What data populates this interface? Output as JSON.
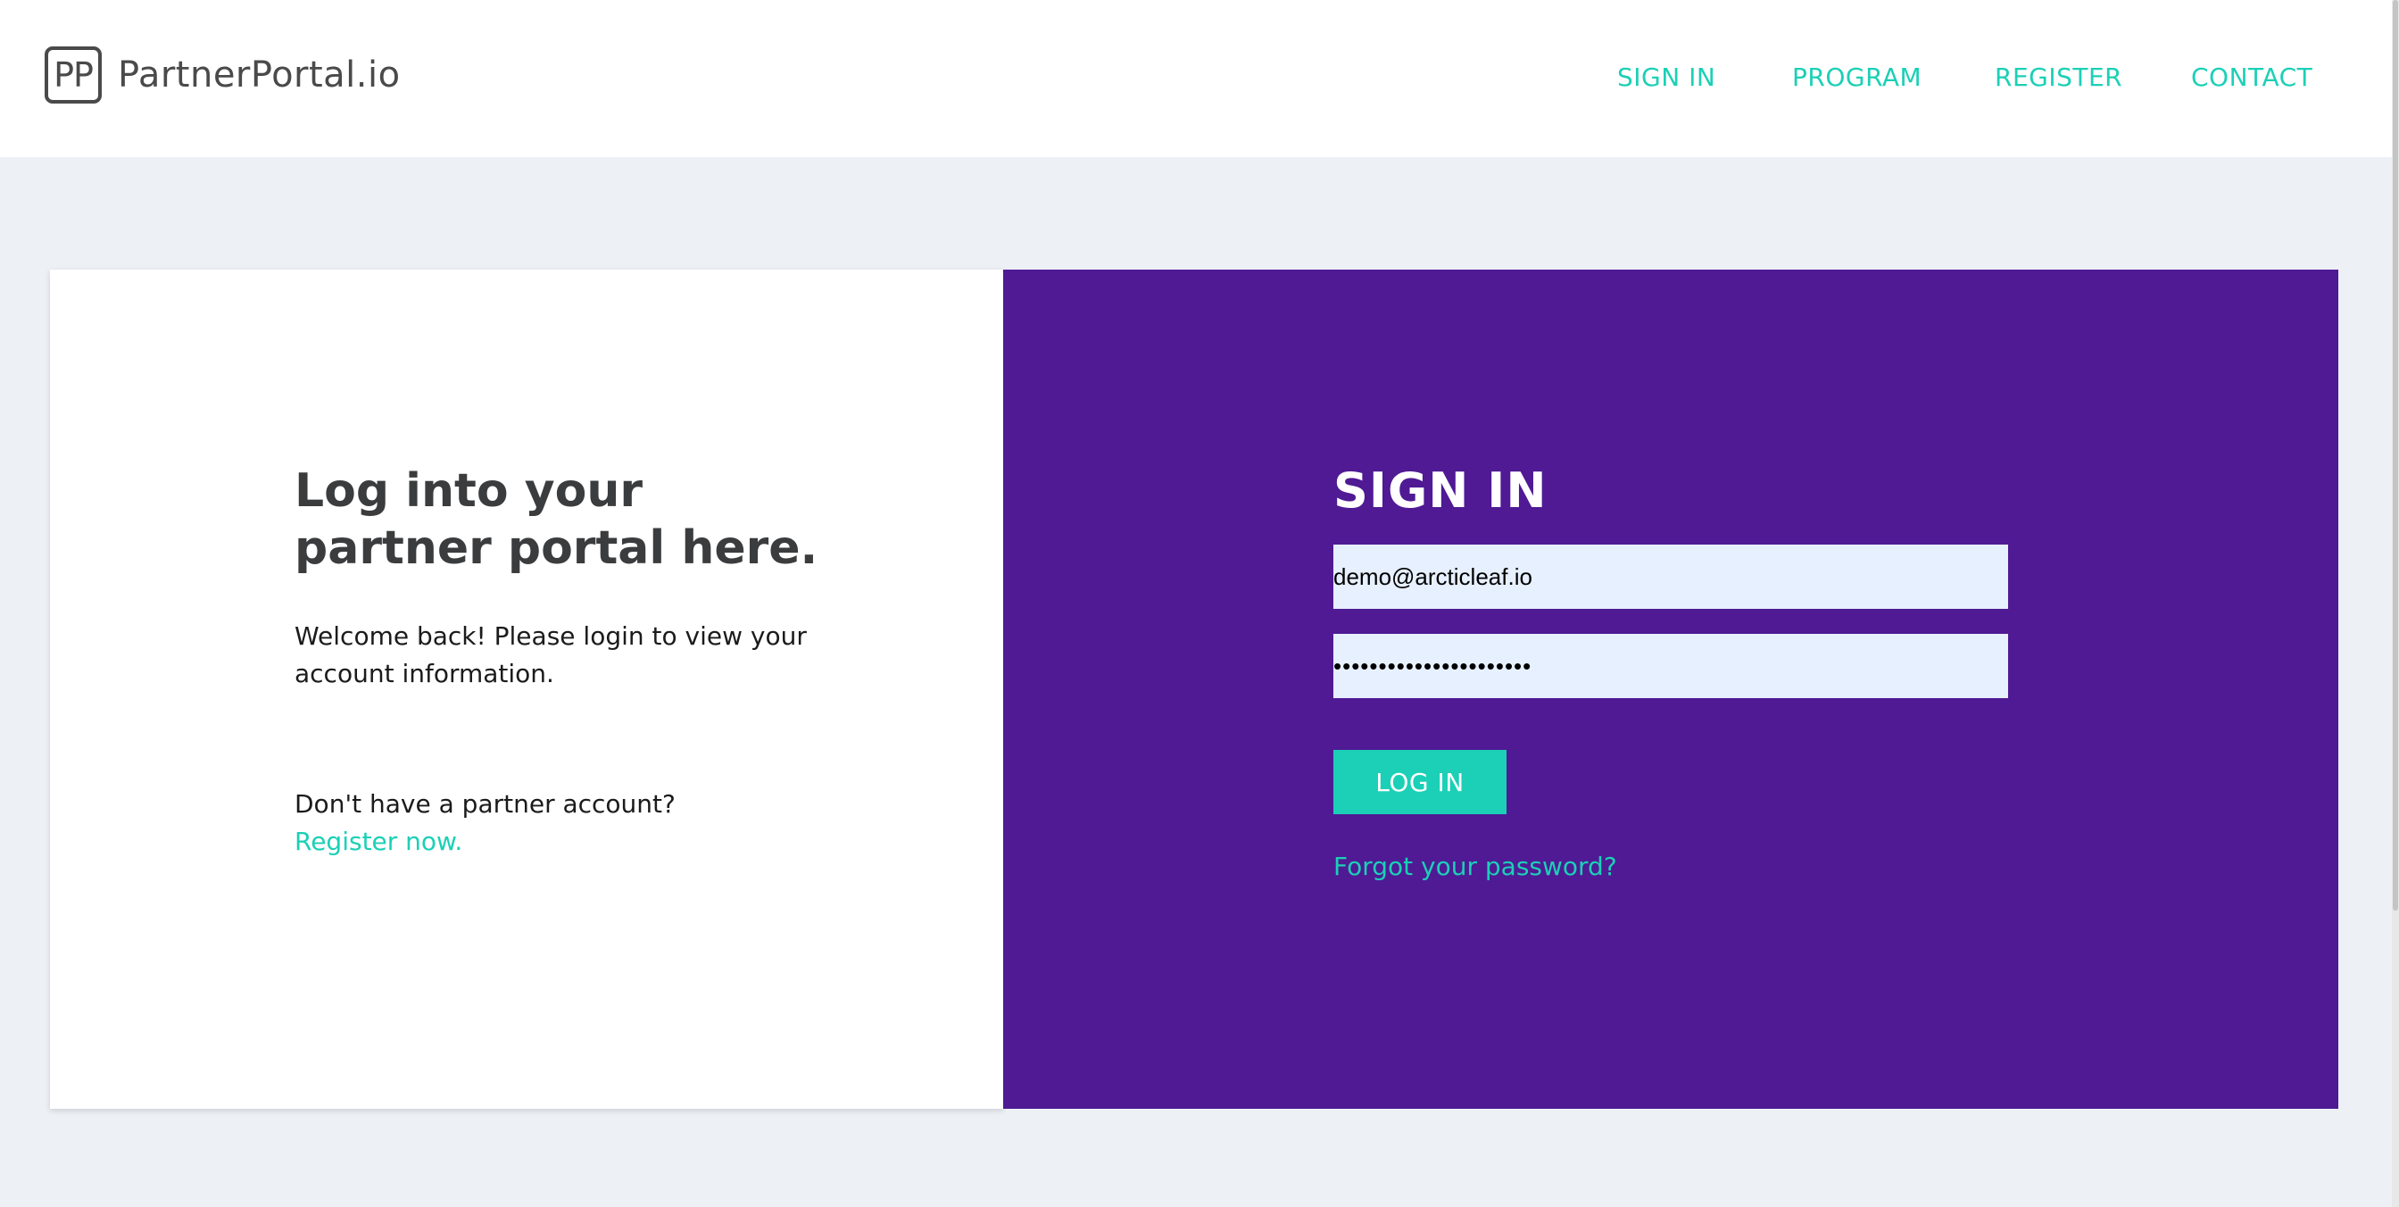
{
  "header": {
    "logo_mark": "PP",
    "logo_text": "PartnerPortal.io",
    "nav": [
      {
        "label": "SIGN IN"
      },
      {
        "label": "PROGRAM"
      },
      {
        "label": "REGISTER"
      },
      {
        "label": "CONTACT"
      }
    ]
  },
  "left_panel": {
    "headline_line1": "Log into your",
    "headline_line2": "partner portal here.",
    "welcome_line1": "Welcome back! Please login to view your",
    "welcome_line2": "account information.",
    "no_account_text": "Don't have a partner account?",
    "register_link": "Register now."
  },
  "signin_form": {
    "title": "SIGN IN",
    "email_value": "demo@arcticleaf.io",
    "password_mask": "••••••••••••••••••••••",
    "login_button": "LOG IN",
    "forgot_link": "Forgot your password?"
  },
  "colors": {
    "accent": "#1bd0b6",
    "panel_purple": "#4f1a94",
    "page_background": "#edf0f5",
    "input_background": "#e7f0fe",
    "heading_text": "#3b3c3e"
  }
}
